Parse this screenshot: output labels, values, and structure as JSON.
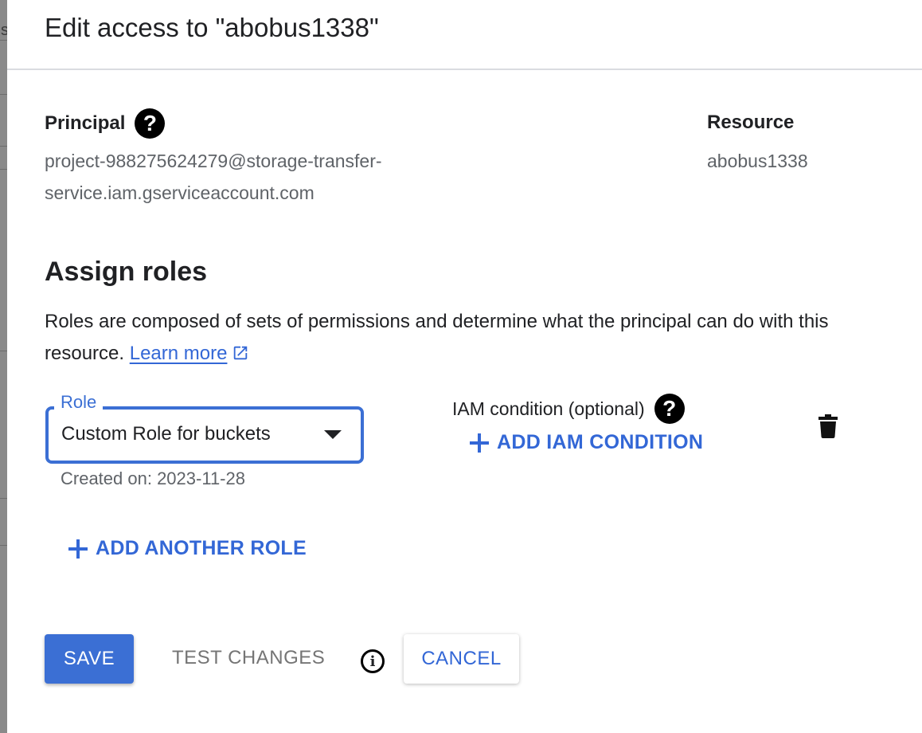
{
  "backdrop": {
    "partial_char": "s"
  },
  "dialog": {
    "title": "Edit access to \"abobus1338\""
  },
  "principal": {
    "label": "Principal",
    "help_icon": "help-circle-icon",
    "value_line1": "project-988275624279@storage-transfer-",
    "value_line2": "service.iam.gserviceaccount.com"
  },
  "resource": {
    "label": "Resource",
    "value": "abobus1338"
  },
  "assign_roles": {
    "title": "Assign roles",
    "description": "Roles are composed of sets of permissions and determine what the principal can do with this resource.",
    "learn_more": "Learn more",
    "learn_more_icon": "open-in-new-icon"
  },
  "role_field": {
    "label": "Role",
    "value": "Custom Role for buckets",
    "helper": "Created on: 2023-11-28",
    "dropdown_icon": "arrow-drop-down-icon"
  },
  "iam_condition": {
    "label": "IAM condition (optional)",
    "help_icon": "help-circle-icon",
    "add_label": "ADD IAM CONDITION"
  },
  "delete_icon": "trash-icon",
  "add_role": {
    "label": "ADD ANOTHER ROLE"
  },
  "actions": {
    "save": "SAVE",
    "test_changes": "TEST CHANGES",
    "info_icon": "info-icon",
    "cancel": "CANCEL"
  },
  "colors": {
    "accent": "#3367d6",
    "field_border": "#3b6fd4",
    "muted_text": "#5f6368",
    "disabled_text": "#757575"
  }
}
